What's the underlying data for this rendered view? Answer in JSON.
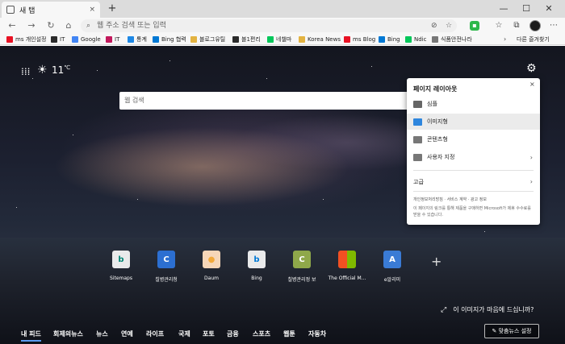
{
  "browser": {
    "tab_title": "새 탭",
    "tab_close": "×",
    "new_tab": "+",
    "window_controls": {
      "minimize": "—",
      "maximize": "☐",
      "close": "✕"
    }
  },
  "nav": {
    "back": "←",
    "forward": "→",
    "refresh": "↻",
    "home": "⌂",
    "address_placeholder": "웹 주소 검색 또는 입력",
    "lock_symbol": "⌕"
  },
  "bookmarks": [
    {
      "label": "ms 개인설정",
      "color": "#e81123"
    },
    {
      "label": "IT",
      "color": "#2b2b2b"
    },
    {
      "label": "Google",
      "color": "#4285f4"
    },
    {
      "label": "IT",
      "color": "#c2185b"
    },
    {
      "label": "통계",
      "color": "#1e88e5"
    },
    {
      "label": "Bing 협력",
      "color": "#0078d4"
    },
    {
      "label": "블로그유틸",
      "color": "#e3b341"
    },
    {
      "label": "블1편리",
      "color": "#2b2b2b"
    },
    {
      "label": "네챌마",
      "color": "#03c75a"
    },
    {
      "label": "Korea News",
      "color": "#e3b341"
    },
    {
      "label": "ms Blog",
      "color": "#e81123"
    },
    {
      "label": "Bing",
      "color": "#0078d4"
    },
    {
      "label": "Ndic",
      "color": "#03c75a"
    },
    {
      "label": "식품안전나라",
      "color": "#777777"
    }
  ],
  "bookmarks_overflow": "›",
  "bookmarks_folder": "다른 즐겨찾기",
  "page": {
    "temperature": "11",
    "temp_unit": "℃",
    "search_placeholder": "웹 검색",
    "quick_links": [
      {
        "label": "Sitemaps",
        "glyph": "b",
        "color": "#008373"
      },
      {
        "label": "칠병관리청",
        "glyph": "C",
        "color": "#2c6fd1"
      },
      {
        "label": "Daum",
        "glyph": "●",
        "color": "#f2a93b"
      },
      {
        "label": "Bing",
        "glyph": "b",
        "color": "#0078d4"
      },
      {
        "label": "칠병관리정 보",
        "glyph": "C",
        "color": "#6b8e23"
      },
      {
        "label": "The Official M...",
        "glyph": "■",
        "color": "#e14b2a"
      },
      {
        "label": "e알리미",
        "glyph": "A",
        "color": "#3a7bd5"
      }
    ],
    "add_link": "+",
    "photo_note": "이 이미지가 마음에 드십니까?",
    "feed_tabs": [
      "내 피드",
      "회제의뉴스",
      "뉴스",
      "연예",
      "라이프",
      "국제",
      "포토",
      "금융",
      "스포츠",
      "웹툰",
      "자동차"
    ],
    "news_settings": "맞춤뉴스 설정"
  },
  "layout_panel": {
    "title": "페이지 레이아웃",
    "close": "×",
    "options": [
      {
        "label": "심플",
        "color": "#666666"
      },
      {
        "label": "이미지형",
        "color": "#2e86de"
      },
      {
        "label": "콘텐츠형",
        "color": "#666666"
      },
      {
        "label": "사용자 지정",
        "color": "#666666"
      }
    ],
    "custom_chevron": "›",
    "advanced": "고급",
    "advanced_chevron": "›",
    "links": "개인정보처리방침 · 서비스 계약 · 광고 정보",
    "note": "이 페이지의 링크를 통해 제품을 구매하면 Microsoft가 제휴 수수료를 받을 수 있습니다."
  }
}
